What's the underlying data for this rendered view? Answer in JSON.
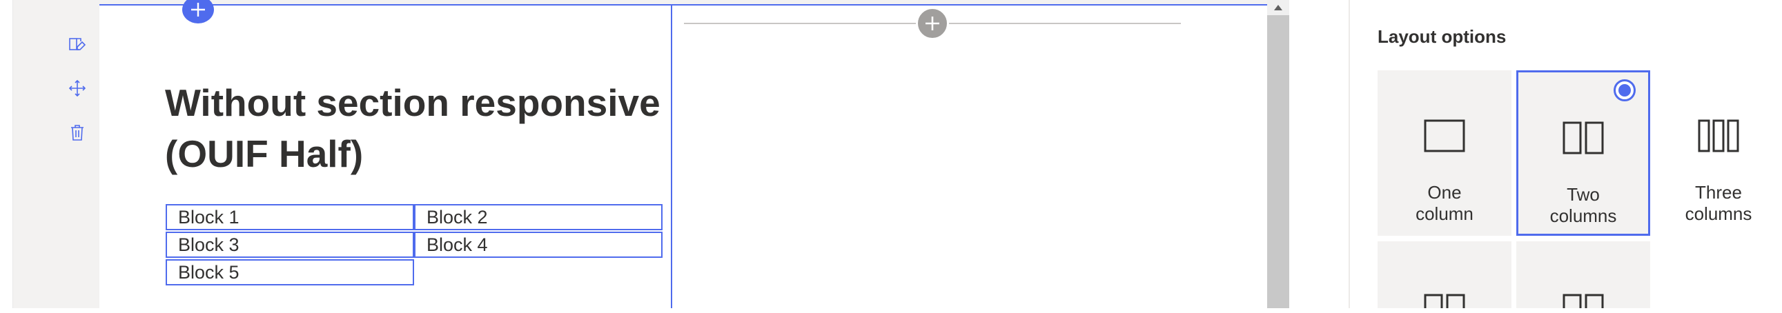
{
  "editor": {
    "heading": "Without section responsive (OUIF Half)",
    "blocks": [
      {
        "label": "Block 1"
      },
      {
        "label": "Block 2"
      },
      {
        "label": "Block 3"
      },
      {
        "label": "Block 4"
      },
      {
        "label": "Block 5"
      }
    ],
    "toolbar_icons": [
      "edit-section-icon",
      "move-icon",
      "delete-icon"
    ]
  },
  "panel": {
    "title": "Layout options",
    "options": [
      {
        "label_line1": "One",
        "label_line2": "column",
        "selected": false
      },
      {
        "label_line1": "Two",
        "label_line2": "columns",
        "selected": true
      },
      {
        "label_line1": "Three",
        "label_line2": "columns",
        "selected": false
      }
    ]
  },
  "colors": {
    "accent": "#4f6bed",
    "canvas_bg": "#f3f2f1",
    "option_bg": "#f3f2f1",
    "text": "#323130"
  }
}
